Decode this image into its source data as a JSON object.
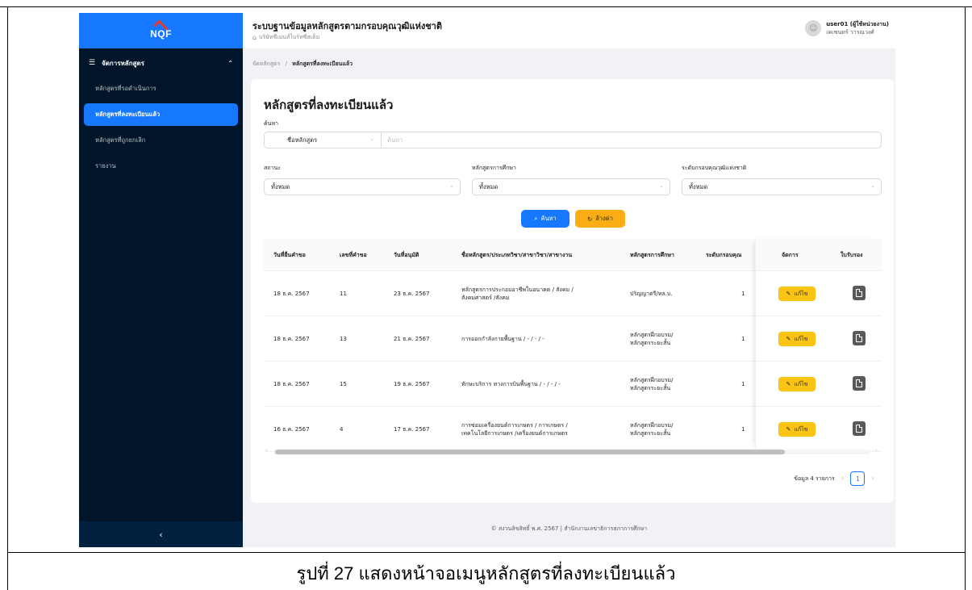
{
  "sidebar": {
    "logo_text": "NQF",
    "menu_group": "จัดการหลักสูตร",
    "items": [
      {
        "label": "หลักสูตรที่รอดำเนินการ"
      },
      {
        "label": "หลักสูตรที่ลงทะเบียนแล้ว"
      },
      {
        "label": "หลักสูตรที่ถูกยกเลิก"
      }
    ],
    "report": "รายงาน",
    "collapse_icon": "chevron-left-icon"
  },
  "header": {
    "title": "ระบบฐานข้อมูลหลักสูตรตามกรอบคุณวุฒิแห่งชาติ",
    "organization": "บริษัทซีเมนส์ไบร์ทซีสเต็ม",
    "user_name": "user01 (ผู้ใช้หน่วยงาน)",
    "user_position": "เคเซนทร์ วารณวงศ์"
  },
  "breadcrumb": {
    "parent": "จัดหลักสูตร",
    "separator": "/",
    "current": "หลักสูตรที่ลงทะเบียนแล้ว"
  },
  "page": {
    "title": "หลักสูตรที่ลงทะเบียนแล้ว"
  },
  "search": {
    "label": "ค้นหา",
    "type_value": "ชื่อหลักสูตร",
    "placeholder": "ค้นหา"
  },
  "filters": {
    "status_label": "สถานะ",
    "status_value": "ทั้งหมด",
    "program_label": "หลักสูตรการศึกษา",
    "program_value": "ทั้งหมด",
    "level_label": "ระดับกรอบคุณวุฒิแห่งชาติ",
    "level_value": "ทั้งหมด"
  },
  "buttons": {
    "search": "ค้นหา",
    "reset": "ล้างค่า",
    "edit": "แก้ไข"
  },
  "table": {
    "columns": [
      "วันที่ยื่นคำขอ",
      "เลขที่คำขอ",
      "วันที่อนุมัติ",
      "ชื่อหลักสูตร/ประเภทวิชา/สาขาวิชา/สาขางาน",
      "หลักสูตรการศึกษา",
      "ระดับกรอบคุณ",
      "จัดการ",
      "ใบรับรอง"
    ],
    "rows": [
      {
        "submit_date": "18 ธ.ค. 2567",
        "request_no": "11",
        "approve_date": "23 ธ.ค. 2567",
        "name1": "หลักสูตรการประกอบอาชีพในอนาคต / สังคม /",
        "name2": "สังคมศาสตร์ /สังคม",
        "program1": "ปริญญาตรี/ทล.บ.",
        "program2": "",
        "level": "1"
      },
      {
        "submit_date": "18 ธ.ค. 2567",
        "request_no": "13",
        "approve_date": "21 ธ.ค. 2567",
        "name1": "การออกกำลังกายพื้นฐาน / - / - / -",
        "name2": "",
        "program1": "หลักสูตรฝึกอบรม/",
        "program2": "หลักสูตรระยะสั้น",
        "level": "1"
      },
      {
        "submit_date": "18 ธ.ค. 2567",
        "request_no": "15",
        "approve_date": "19 ธ.ค. 2567",
        "name1": "ทักษะบริการ ทางการบินพื้นฐาน / - / - / -",
        "name2": "",
        "program1": "หลักสูตรฝึกอบรม/",
        "program2": "หลักสูตรระยะสั้น",
        "level": "1"
      },
      {
        "submit_date": "16 ธ.ค. 2567",
        "request_no": "4",
        "approve_date": "17 ธ.ค. 2567",
        "name1": "การซ่อมเครื่องยนต์การเกษตร / การเกษตร /",
        "name2": "เทคโนโลยีการเกษตร /เครื่องยนต์การเกษตร",
        "program1": "หลักสูตรฝึกอบรม/",
        "program2": "หลักสูตรระยะสั้น",
        "level": "1"
      }
    ]
  },
  "pagination": {
    "total_text": "ข้อมูล 4 รายการ",
    "current_page": "1"
  },
  "footer": {
    "text": "© สงวนลิขสิทธิ์ พ.ศ. 2567 | สำนักงานเลขาธิการสภาการศึกษา"
  },
  "caption": "รูปที่ 27 แสดงหน้าจอเมนูหลักสูตรที่ลงทะเบียนแล้ว",
  "colors": {
    "primary": "#1677ff",
    "warning": "#faad14",
    "sidebar": "#001529"
  }
}
